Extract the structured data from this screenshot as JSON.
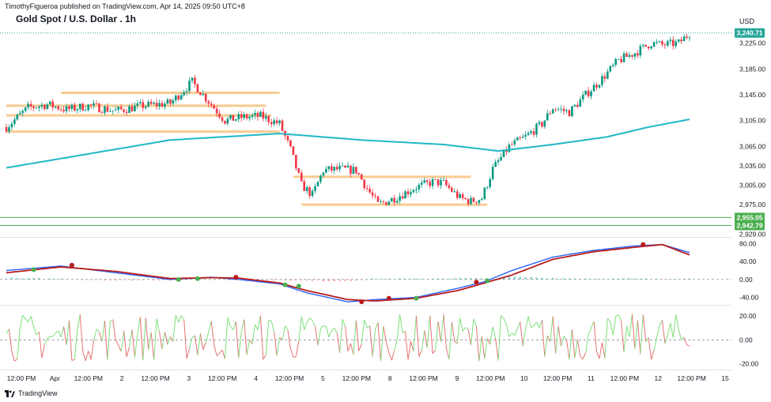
{
  "header": {
    "publisher_line": "TimothyFigueroa published on TradingView.com, Apr 14, 2025 09:50 UTC+8",
    "title": "Gold Spot / U.S. Dollar . 1h",
    "currency": "USD"
  },
  "footer": {
    "brand": "TradingView"
  },
  "colors": {
    "up": "#089981",
    "down": "#f23645",
    "ma": "#1fb7c4",
    "zone": "#f7c27f",
    "support": "#4caf50",
    "price_badge": "#26a69a",
    "macd_fast": "#2962ff",
    "macd_slow_up": "#4caf50",
    "macd_slow_down": "#b71c1c",
    "osc_up": "#7ee07a",
    "osc_down": "#e57373"
  },
  "chart_data": [
    {
      "type": "candlestick",
      "title": "Gold Spot / U.S. Dollar . 1h",
      "ylim": [
        2925,
        3255
      ],
      "y_ticks": [
        "3,225.00",
        "3,185.00",
        "3,145.00",
        "3,105.00",
        "3,065.00",
        "3,035.00",
        "3,005.00",
        "2,975.00",
        "2,929.00"
      ],
      "y_tick_values": [
        3225,
        3185,
        3145,
        3105,
        3065,
        3035,
        3005,
        2975,
        2929
      ],
      "x_ticks": [
        "12:00 PM",
        "Apr",
        "12:00 PM",
        "2",
        "12:00 PM",
        "3",
        "12:00 PM",
        "4",
        "12:00 PM",
        "5",
        "12:00 PM",
        "8",
        "12:00 PM",
        "9",
        "12:00 PM",
        "10",
        "12:00 PM",
        "11",
        "12:00 PM",
        "12",
        "12:00 PM",
        "15"
      ],
      "anchors": [
        [
          0,
          3095
        ],
        [
          8,
          3125
        ],
        [
          15,
          3130
        ],
        [
          22,
          3122
        ],
        [
          30,
          3128
        ],
        [
          40,
          3120
        ],
        [
          50,
          3128
        ],
        [
          60,
          3132
        ],
        [
          68,
          3165
        ],
        [
          74,
          3135
        ],
        [
          80,
          3105
        ],
        [
          86,
          3110
        ],
        [
          93,
          3112
        ],
        [
          100,
          3100
        ],
        [
          104,
          3060
        ],
        [
          108,
          3005
        ],
        [
          112,
          2990
        ],
        [
          116,
          3028
        ],
        [
          122,
          3030
        ],
        [
          128,
          3028
        ],
        [
          132,
          3000
        ],
        [
          136,
          2975
        ],
        [
          142,
          2985
        ],
        [
          150,
          3002
        ],
        [
          156,
          3010
        ],
        [
          160,
          3008
        ],
        [
          166,
          2985
        ],
        [
          170,
          2980
        ],
        [
          174,
          2985
        ],
        [
          178,
          3030
        ],
        [
          184,
          3065
        ],
        [
          190,
          3080
        ],
        [
          196,
          3100
        ],
        [
          200,
          3125
        ],
        [
          206,
          3118
        ],
        [
          212,
          3145
        ],
        [
          218,
          3170
        ],
        [
          224,
          3198
        ],
        [
          230,
          3210
        ],
        [
          236,
          3225
        ],
        [
          240,
          3222
        ],
        [
          246,
          3225
        ],
        [
          250,
          3240
        ]
      ],
      "candle_count": 251,
      "moving_average": [
        [
          0,
          3032
        ],
        [
          60,
          3075
        ],
        [
          100,
          3085
        ],
        [
          130,
          3075
        ],
        [
          160,
          3068
        ],
        [
          180,
          3058
        ],
        [
          200,
          3068
        ],
        [
          220,
          3080
        ],
        [
          235,
          3095
        ],
        [
          250,
          3107
        ]
      ],
      "zones": [
        {
          "from": 20,
          "to": 100,
          "value": 3148
        },
        {
          "from": 0,
          "to": 95,
          "value": 3128
        },
        {
          "from": 0,
          "to": 97,
          "value": 3113
        },
        {
          "from": 0,
          "to": 100,
          "value": 3088
        },
        {
          "from": 105,
          "to": 170,
          "value": 3018
        },
        {
          "from": 108,
          "to": 176,
          "value": 2975
        }
      ],
      "support_lines": [
        2955.05,
        2942.79
      ],
      "price_labels": [
        {
          "value": 3240.71,
          "text": "3,240.71"
        },
        {
          "value": 2955.05,
          "text": "2,955.05"
        },
        {
          "value": 2942.79,
          "text": "2,942.79"
        }
      ]
    },
    {
      "type": "line",
      "name": "MACD-style oscillator",
      "ylim": [
        -55,
        95
      ],
      "y_ticks": [
        "80.00",
        "40.00",
        "0.00",
        "-40.00"
      ],
      "y_tick_values": [
        80,
        40,
        0,
        -40
      ],
      "fast_line": [
        [
          0,
          20
        ],
        [
          20,
          30
        ],
        [
          40,
          15
        ],
        [
          60,
          0
        ],
        [
          75,
          5
        ],
        [
          85,
          0
        ],
        [
          100,
          -10
        ],
        [
          110,
          -30
        ],
        [
          125,
          -50
        ],
        [
          135,
          -45
        ],
        [
          150,
          -40
        ],
        [
          165,
          -20
        ],
        [
          175,
          -5
        ],
        [
          185,
          20
        ],
        [
          200,
          50
        ],
        [
          215,
          65
        ],
        [
          230,
          75
        ],
        [
          240,
          78
        ],
        [
          250,
          60
        ]
      ],
      "slow_line": [
        [
          0,
          15
        ],
        [
          20,
          28
        ],
        [
          40,
          18
        ],
        [
          60,
          2
        ],
        [
          75,
          4
        ],
        [
          85,
          3
        ],
        [
          100,
          -8
        ],
        [
          110,
          -25
        ],
        [
          125,
          -45
        ],
        [
          135,
          -48
        ],
        [
          150,
          -42
        ],
        [
          165,
          -25
        ],
        [
          175,
          -8
        ],
        [
          185,
          10
        ],
        [
          200,
          45
        ],
        [
          215,
          62
        ],
        [
          230,
          72
        ],
        [
          240,
          78
        ],
        [
          250,
          55
        ]
      ],
      "cross_markers": [
        {
          "x": 10,
          "value": 22,
          "dir": "up"
        },
        {
          "x": 24,
          "value": 32,
          "dir": "down"
        },
        {
          "x": 63,
          "value": 0,
          "dir": "up"
        },
        {
          "x": 70,
          "value": 2,
          "dir": "up"
        },
        {
          "x": 84,
          "value": 5,
          "dir": "down"
        },
        {
          "x": 102,
          "value": -12,
          "dir": "up"
        },
        {
          "x": 107,
          "value": -15,
          "dir": "up"
        },
        {
          "x": 130,
          "value": -50,
          "dir": "down"
        },
        {
          "x": 140,
          "value": -42,
          "dir": "down"
        },
        {
          "x": 150,
          "value": -42,
          "dir": "up"
        },
        {
          "x": 172,
          "value": -6,
          "dir": "down"
        },
        {
          "x": 176,
          "value": -3,
          "dir": "up"
        },
        {
          "x": 233,
          "value": 78,
          "dir": "down"
        }
      ]
    },
    {
      "type": "line",
      "name": "Oscillator",
      "ylim": [
        -25,
        28
      ],
      "y_ticks": [
        "20.00",
        "0.00",
        "-20.00"
      ],
      "y_tick_values": [
        20,
        0,
        -20
      ]
    }
  ]
}
